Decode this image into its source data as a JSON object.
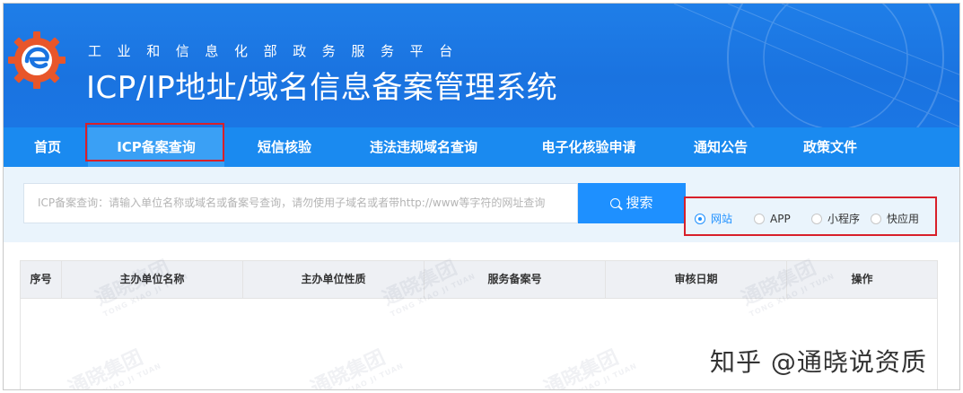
{
  "header": {
    "subtitle": "工业和信息化部政务服务平台",
    "title": "ICP/IP地址/域名信息备案管理系统"
  },
  "nav": {
    "items": [
      {
        "label": "首页"
      },
      {
        "label": "ICP备案查询",
        "active": true
      },
      {
        "label": "短信核验"
      },
      {
        "label": "违法违规域名查询"
      },
      {
        "label": "电子化核验申请"
      },
      {
        "label": "通知公告"
      },
      {
        "label": "政策文件"
      }
    ]
  },
  "search": {
    "placeholder": "ICP备案查询：请输入单位名称或域名或备案号查询，请勿使用子域名或者带http://www等字符的网址查询",
    "button_label": "搜索"
  },
  "type_filter": {
    "options": [
      {
        "label": "网站",
        "selected": true
      },
      {
        "label": "APP",
        "selected": false
      },
      {
        "label": "小程序",
        "selected": false
      },
      {
        "label": "快应用",
        "selected": false
      }
    ]
  },
  "table": {
    "columns": [
      "序号",
      "主办单位名称",
      "主办单位性质",
      "服务备案号",
      "审核日期",
      "操作"
    ],
    "rows": []
  },
  "watermark": {
    "text": "通晓集团",
    "sub": "TONG XIAO JI TUAN"
  },
  "credit": "知乎 @通晓说资质",
  "colors": {
    "header_blue": "#1a73e0",
    "nav_blue": "#1a8af0",
    "accent": "#1e90ff",
    "highlight_red": "#d8202a"
  }
}
